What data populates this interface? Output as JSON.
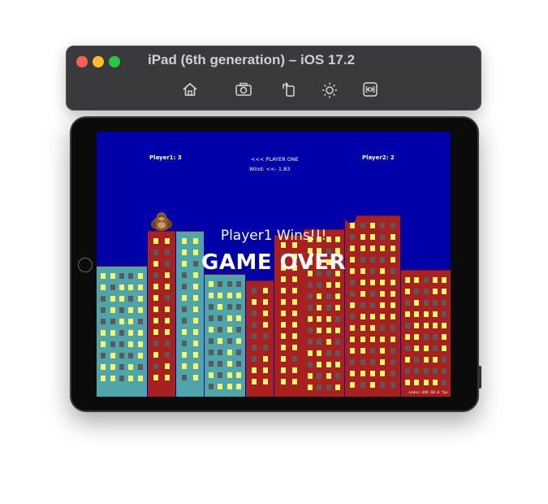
{
  "simulator": {
    "title": "iPad (6th generation) – iOS 17.2",
    "toolbar": [
      {
        "name": "home-icon",
        "label": "Home"
      },
      {
        "name": "screenshot-icon",
        "label": "Screenshot"
      },
      {
        "name": "rotate-icon",
        "label": "Rotate"
      },
      {
        "name": "appearance-icon",
        "label": "Appearance"
      },
      {
        "name": "command-icon",
        "label": "Command"
      }
    ]
  },
  "game": {
    "player1_score": "Player1: 3",
    "turn_indicator": "<<< PLAYER ONE",
    "wind": "Wind: <<- 1.83",
    "player2_score": "Player2: 2",
    "win_message": "Player1 Wins!!!",
    "game_over": "GAME OVER",
    "debug_stats": "nodes:448  60.0 fps"
  },
  "colors": {
    "sky": "#0000a8",
    "brick_red": "#a82020",
    "teal": "#4ea6aa",
    "lit_window": "#f8f868",
    "dark_window": "#5a5a5a",
    "gorilla": "#8b5a2b"
  }
}
